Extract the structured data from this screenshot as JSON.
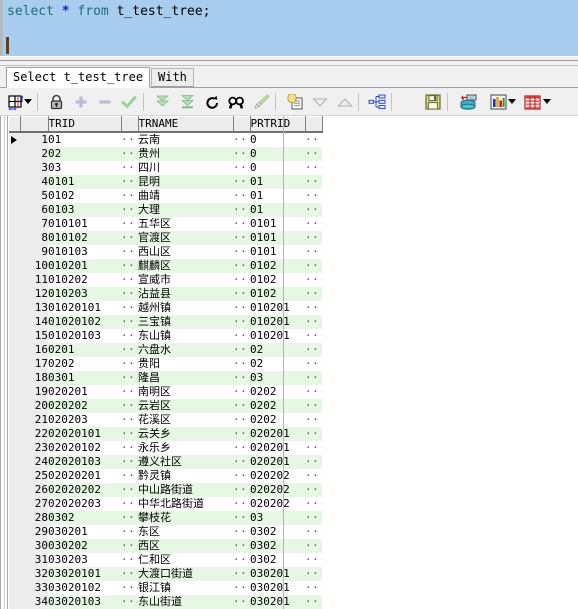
{
  "editor": {
    "sql_keyword1": "select",
    "sql_star": "*",
    "sql_keyword2": "from",
    "sql_table": "t_test_tree;",
    "full_sql": "select * from t_test_tree;",
    "colors": {
      "keyword": "#1a6e78",
      "operator": "#2020c8",
      "identifier": "#000000",
      "selection_bg": "#a8cdee",
      "caret": "#6b3d10"
    }
  },
  "tabs": [
    {
      "label": "Select t_test_tree",
      "active": true
    },
    {
      "label": "With",
      "active": false
    }
  ],
  "toolbar": {
    "items": [
      {
        "name": "grid-layout-icon",
        "label": "Grid Layout",
        "has_caret": true
      },
      {
        "name": "lock-icon",
        "label": "Lock Record"
      },
      {
        "name": "plus-icon",
        "label": "Insert Record"
      },
      {
        "name": "minus-icon",
        "label": "Delete Record"
      },
      {
        "name": "check-icon",
        "label": "Post Edit"
      },
      {
        "name": "fetch-next-icon",
        "label": "Fetch Next Page"
      },
      {
        "name": "fetch-all-icon",
        "label": "Fetch All"
      },
      {
        "name": "refresh-icon",
        "label": "Refresh"
      },
      {
        "name": "find-icon",
        "label": "Find"
      },
      {
        "name": "highlight-icon",
        "label": "Highlight"
      },
      {
        "name": "copy-icon",
        "label": "Copy Data"
      },
      {
        "name": "sort-desc-icon",
        "label": "Sort Descending"
      },
      {
        "name": "sort-asc-icon",
        "label": "Sort Ascending"
      },
      {
        "name": "hierarchy-icon",
        "label": "Master/Detail"
      },
      {
        "name": "save-icon",
        "label": "Export"
      },
      {
        "name": "database-export-icon",
        "label": "Export to DB"
      },
      {
        "name": "chart-icon",
        "label": "Chart",
        "has_caret": true
      },
      {
        "name": "table-grid-icon",
        "label": "Data Grid",
        "has_caret": true
      }
    ]
  },
  "grid": {
    "columns": [
      "TRID",
      "TRNAME",
      "PRTRID"
    ],
    "current_row": 1,
    "ellipsis": "···",
    "rows": [
      {
        "n": 1,
        "TRID": "01",
        "TRNAME": "云南",
        "PRTRID": "0"
      },
      {
        "n": 2,
        "TRID": "02",
        "TRNAME": "贵州",
        "PRTRID": "0"
      },
      {
        "n": 3,
        "TRID": "03",
        "TRNAME": "四川",
        "PRTRID": "0"
      },
      {
        "n": 4,
        "TRID": "0101",
        "TRNAME": "昆明",
        "PRTRID": "01"
      },
      {
        "n": 5,
        "TRID": "0102",
        "TRNAME": "曲靖",
        "PRTRID": "01"
      },
      {
        "n": 6,
        "TRID": "0103",
        "TRNAME": "大理",
        "PRTRID": "01"
      },
      {
        "n": 7,
        "TRID": "010101",
        "TRNAME": "五华区",
        "PRTRID": "0101"
      },
      {
        "n": 8,
        "TRID": "010102",
        "TRNAME": "官渡区",
        "PRTRID": "0101"
      },
      {
        "n": 9,
        "TRID": "010103",
        "TRNAME": "西山区",
        "PRTRID": "0101"
      },
      {
        "n": 10,
        "TRID": "010201",
        "TRNAME": "麒麟区",
        "PRTRID": "0102"
      },
      {
        "n": 11,
        "TRID": "010202",
        "TRNAME": "宣威市",
        "PRTRID": "0102"
      },
      {
        "n": 12,
        "TRID": "010203",
        "TRNAME": "沾益县",
        "PRTRID": "0102"
      },
      {
        "n": 13,
        "TRID": "01020101",
        "TRNAME": "越州镇",
        "PRTRID": "010201"
      },
      {
        "n": 14,
        "TRID": "01020102",
        "TRNAME": "三宝镇",
        "PRTRID": "010201"
      },
      {
        "n": 15,
        "TRID": "01020103",
        "TRNAME": "东山镇",
        "PRTRID": "010201"
      },
      {
        "n": 16,
        "TRID": "0201",
        "TRNAME": "六盘水",
        "PRTRID": "02"
      },
      {
        "n": 17,
        "TRID": "0202",
        "TRNAME": "贵阳",
        "PRTRID": "02"
      },
      {
        "n": 18,
        "TRID": "0301",
        "TRNAME": "隆昌",
        "PRTRID": "03"
      },
      {
        "n": 19,
        "TRID": "020201",
        "TRNAME": "南明区",
        "PRTRID": "0202"
      },
      {
        "n": 20,
        "TRID": "020202",
        "TRNAME": "云岩区",
        "PRTRID": "0202"
      },
      {
        "n": 21,
        "TRID": "020203",
        "TRNAME": "花溪区",
        "PRTRID": "0202"
      },
      {
        "n": 22,
        "TRID": "02020101",
        "TRNAME": "云关乡",
        "PRTRID": "020201"
      },
      {
        "n": 23,
        "TRID": "02020102",
        "TRNAME": "永乐乡",
        "PRTRID": "020201"
      },
      {
        "n": 24,
        "TRID": "02020103",
        "TRNAME": "遵义社区",
        "PRTRID": "020201"
      },
      {
        "n": 25,
        "TRID": "02020201",
        "TRNAME": "黔灵镇",
        "PRTRID": "020202"
      },
      {
        "n": 26,
        "TRID": "02020202",
        "TRNAME": "中山路街道",
        "PRTRID": "020202"
      },
      {
        "n": 27,
        "TRID": "02020203",
        "TRNAME": "中华北路街道",
        "PRTRID": "020202"
      },
      {
        "n": 28,
        "TRID": "0302",
        "TRNAME": "攀枝花",
        "PRTRID": "03"
      },
      {
        "n": 29,
        "TRID": "030201",
        "TRNAME": "东区",
        "PRTRID": "0302"
      },
      {
        "n": 30,
        "TRID": "030202",
        "TRNAME": "西区",
        "PRTRID": "0302"
      },
      {
        "n": 31,
        "TRID": "030203",
        "TRNAME": "仁和区",
        "PRTRID": "0302"
      },
      {
        "n": 32,
        "TRID": "03020101",
        "TRNAME": "大渡口街道",
        "PRTRID": "030201"
      },
      {
        "n": 33,
        "TRID": "03020102",
        "TRNAME": "银江镇",
        "PRTRID": "030201"
      },
      {
        "n": 34,
        "TRID": "03020103",
        "TRNAME": "东山街道",
        "PRTRID": "030201"
      }
    ]
  }
}
